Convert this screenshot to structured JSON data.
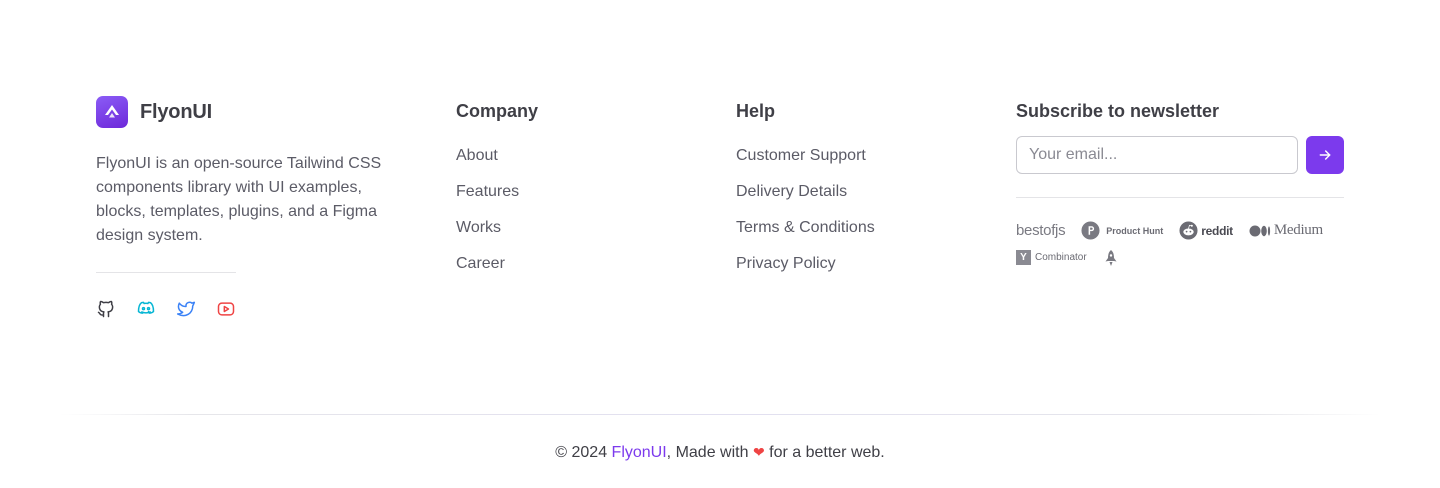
{
  "brand": {
    "name": "FlyonUI",
    "description": "FlyonUI is an open-source Tailwind CSS components library with UI examples, blocks, templates, plugins, and a Figma design system.",
    "logo_color": "#7c3aed",
    "socials": [
      {
        "name": "github",
        "icon": "github-icon",
        "color": "#3f3f46"
      },
      {
        "name": "discord",
        "icon": "discord-icon",
        "color": "#06b6d4"
      },
      {
        "name": "twitter",
        "icon": "twitter-icon",
        "color": "#3b82f6"
      },
      {
        "name": "youtube",
        "icon": "youtube-icon",
        "color": "#ef4444"
      }
    ]
  },
  "company": {
    "title": "Company",
    "links": [
      "About",
      "Features",
      "Works",
      "Career"
    ]
  },
  "help": {
    "title": "Help",
    "links": [
      "Customer Support",
      "Delivery Details",
      "Terms & Conditions",
      "Privacy Policy"
    ]
  },
  "newsletter": {
    "title": "Subscribe to newsletter",
    "placeholder": "Your email...",
    "submit_icon": "arrow-right-icon",
    "accent": "#7c3aed",
    "partners": {
      "bestofjs": "bestofjs",
      "producthunt": "Product Hunt",
      "reddit": "reddit",
      "medium": "Medium",
      "ycombinator": "Combinator",
      "yc_letter": "Y",
      "rocket_icon": "rocket-icon"
    }
  },
  "footer": {
    "copyright_prefix": "© 2024 ",
    "brand_link": "FlyonUI",
    "made_with": ", Made with ",
    "heart": "❤",
    "suffix": " for a better web.",
    "heart_color": "#ef4444"
  }
}
